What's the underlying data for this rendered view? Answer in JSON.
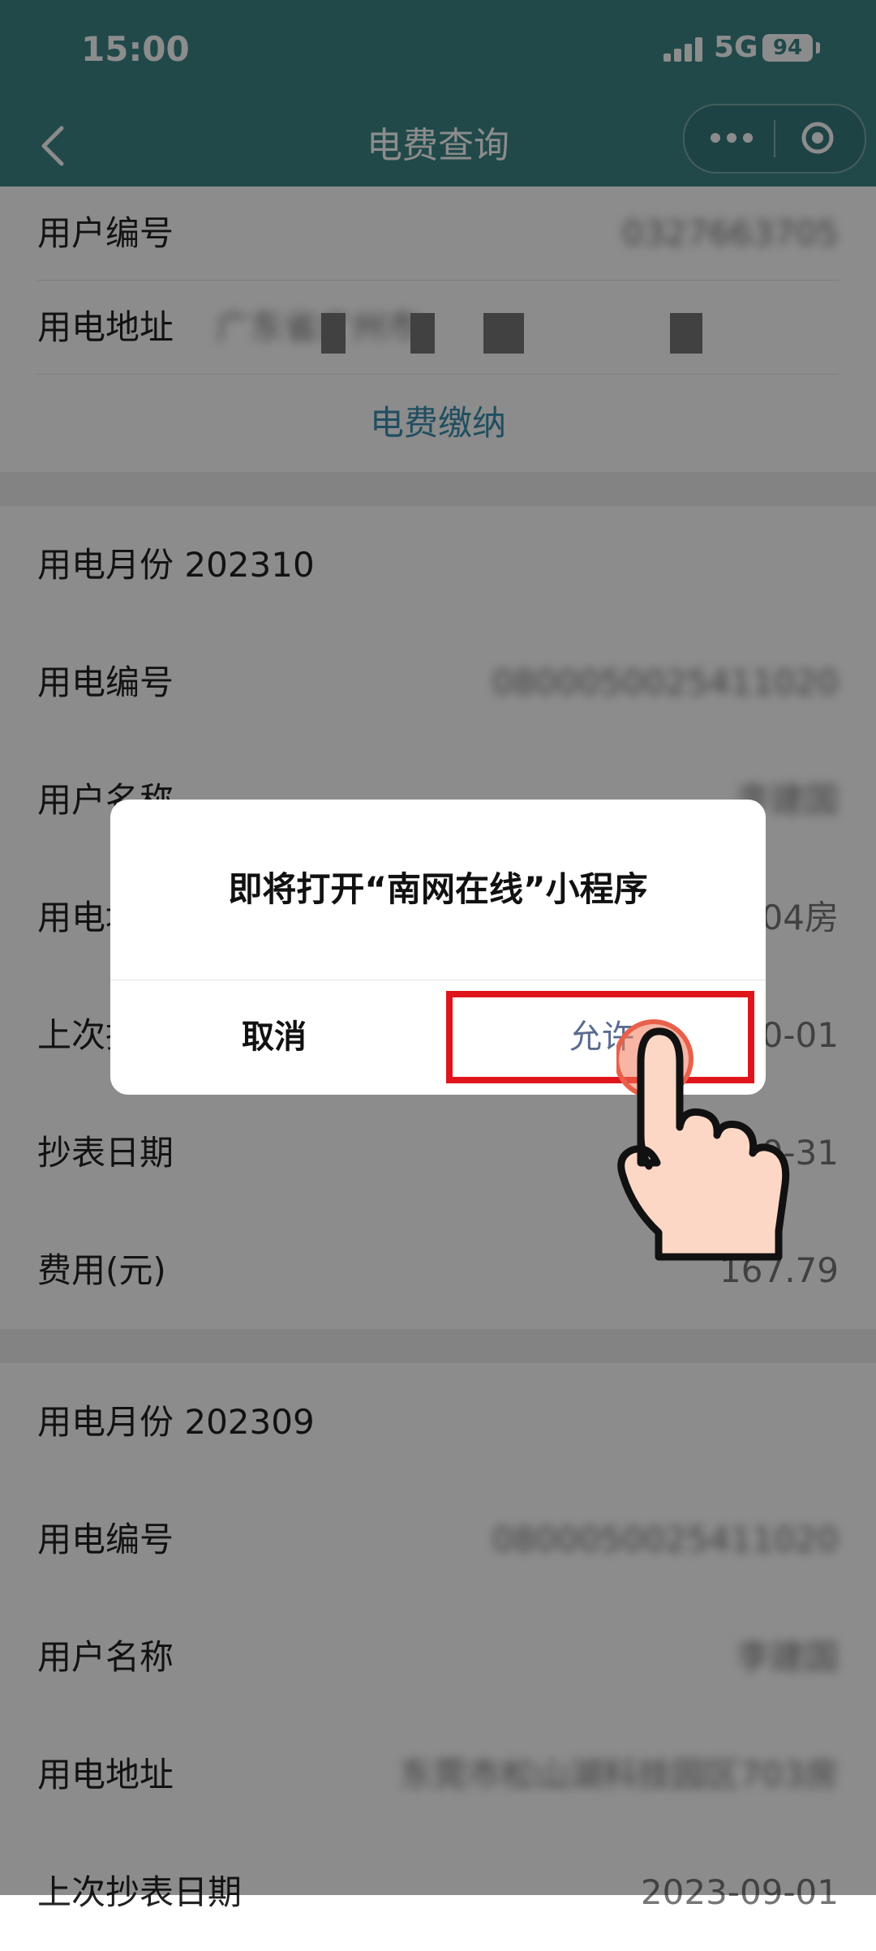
{
  "status_bar": {
    "time": "15:00",
    "network": "5G",
    "battery": "94"
  },
  "nav": {
    "title": "电费查询"
  },
  "account": {
    "user_no_label": "用户编号",
    "user_no_value": "0327663705",
    "address_label": "用电地址",
    "address_value": "广东省广州市",
    "pay_button": "电费缴纳"
  },
  "bills": [
    {
      "month_label": "用电月份 202310",
      "rows": [
        {
          "label": "用电编号",
          "value": "0800050025411020"
        },
        {
          "label": "用户名称",
          "value": "李建国"
        },
        {
          "label": "用电地址",
          "value": "04房"
        },
        {
          "label": "上次抄表日期",
          "value": "2023-10-01"
        },
        {
          "label": "抄表日期",
          "value": "2023-10-31"
        },
        {
          "label": "费用(元)",
          "value": "167.79"
        }
      ]
    },
    {
      "month_label": "用电月份 202309",
      "rows": [
        {
          "label": "用电编号",
          "value": "0800050025411020"
        },
        {
          "label": "用户名称",
          "value": "李建国"
        },
        {
          "label": "用电地址",
          "value": "东莞市松山湖科技园区703房"
        },
        {
          "label": "上次抄表日期",
          "value": "2023-09-01"
        }
      ]
    }
  ],
  "dialog": {
    "message": "即将打开“南网在线”小程序",
    "cancel": "取消",
    "allow": "允许"
  },
  "colors": {
    "header": "#3d8587",
    "highlight": "#e0151c",
    "link": "#3d8fb0"
  }
}
